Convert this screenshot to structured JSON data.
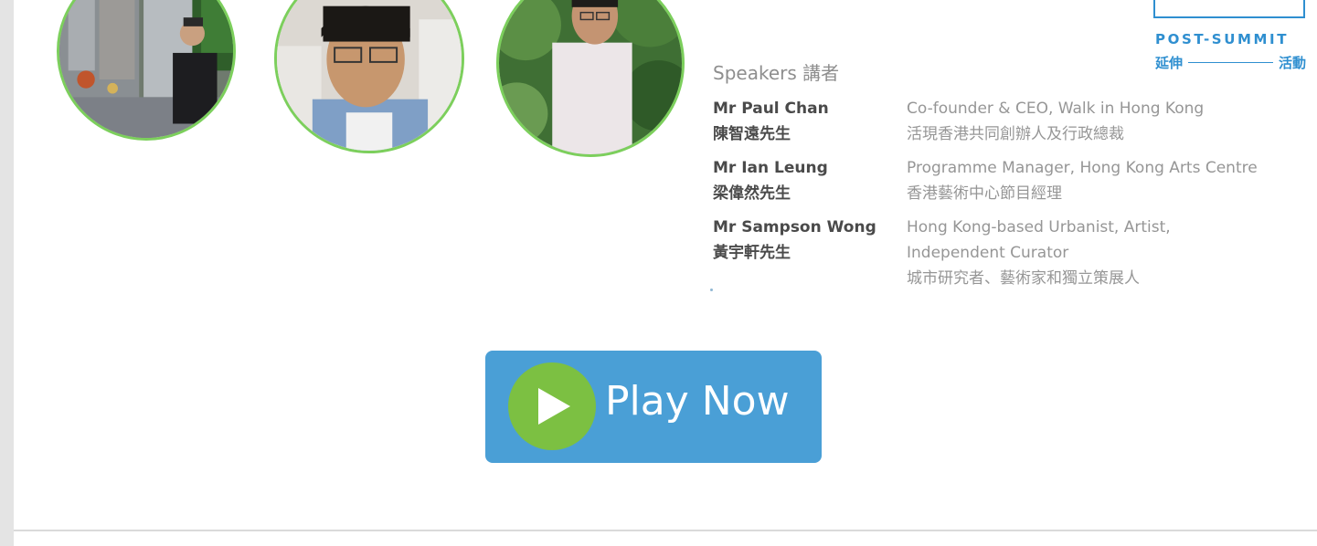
{
  "speakers_heading": "Speakers 講者",
  "post_summit": {
    "title": "POST-SUMMIT",
    "subtitle_left": "延伸",
    "subtitle_right": "活動"
  },
  "speakers": [
    {
      "name_en": "Mr Paul Chan",
      "name_zh": "陳智遠先生",
      "role_lines": [
        "Co-founder & CEO, Walk in Hong Kong",
        "活現香港共同創辦人及行政總裁"
      ]
    },
    {
      "name_en": "Mr Ian Leung",
      "name_zh": "梁偉然先生",
      "role_lines": [
        "Programme Manager, Hong Kong Arts Centre",
        "香港藝術中心節目經理"
      ]
    },
    {
      "name_en": "Mr Sampson Wong",
      "name_zh": "黃宇軒先生",
      "role_lines": [
        "Hong Kong-based Urbanist, Artist,",
        "Independent Curator",
        "城市研究者、藝術家和獨立策展人"
      ]
    }
  ],
  "play_button": {
    "label": "Play Now"
  },
  "colors": {
    "accent_blue": "#2f8fd0",
    "button_blue": "#4a9fd6",
    "play_green": "#7cc042",
    "photo_ring": "#7ccf5c"
  }
}
